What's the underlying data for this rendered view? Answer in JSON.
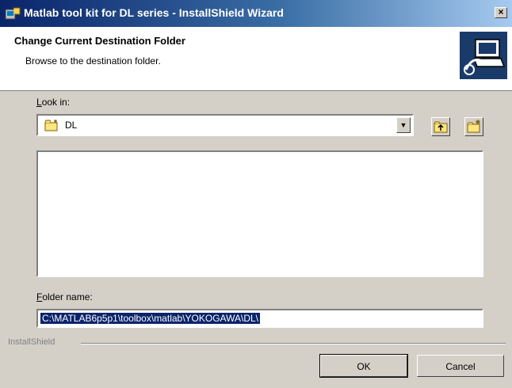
{
  "window": {
    "title": "Matlab tool kit for DL series - InstallShield Wizard",
    "close_glyph": "×"
  },
  "header": {
    "title": "Change Current Destination Folder",
    "subtitle": "Browse to the destination folder.",
    "logo_icon": "computer-install-icon"
  },
  "look_in": {
    "label_u": "L",
    "label_rest": "ook in:",
    "value": "DL",
    "icon": "folder-icon"
  },
  "toolbar": {
    "up_icon": "folder-up-icon",
    "new_icon": "new-folder-icon"
  },
  "folder_name": {
    "label_u": "F",
    "label_rest": "older name:",
    "value": "C:\\MATLAB6p5p1\\toolbox\\matlab\\YOKOGAWA\\DL\\"
  },
  "footer": {
    "brand": "InstallShield",
    "ok_label": "OK",
    "cancel_label": "Cancel"
  },
  "colors": {
    "face": "#d4d0c8",
    "title_start": "#0a246a",
    "title_end": "#a6caf0",
    "selection": "#0a246a"
  }
}
